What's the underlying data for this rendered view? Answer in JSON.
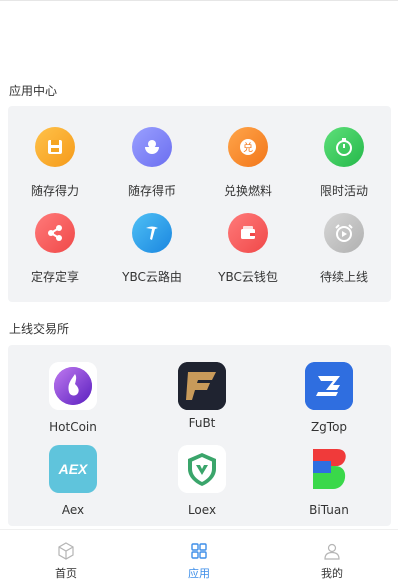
{
  "sections": {
    "apps_title": "应用中心",
    "exchanges_title": "上线交易所"
  },
  "apps": [
    {
      "label": "随存得力",
      "icon": "floppy-icon",
      "color": "#f5a623"
    },
    {
      "label": "随存得币",
      "icon": "bowl-icon",
      "color": "#7b7ff0"
    },
    {
      "label": "兑换燃料",
      "icon": "exchange-icon",
      "color": "#f58a1f"
    },
    {
      "label": "限时活动",
      "icon": "stopwatch-icon",
      "color": "#34c759"
    },
    {
      "label": "定存定享",
      "icon": "share-icon",
      "color": "#f25a5a"
    },
    {
      "label": "YBC云路由",
      "icon": "router-icon",
      "color": "#2b9be8"
    },
    {
      "label": "YBC云钱包",
      "icon": "wallet-icon",
      "color": "#f25a5a"
    },
    {
      "label": "待续上线",
      "icon": "alarm-clock-icon",
      "color": "#b8b8b8"
    }
  ],
  "exchanges": [
    {
      "label": "HotCoin",
      "icon": "hotcoin-logo-icon"
    },
    {
      "label": "FuBt",
      "icon": "fubt-logo-icon"
    },
    {
      "label": "ZgTop",
      "icon": "zgtop-logo-icon"
    },
    {
      "label": "Aex",
      "icon": "aex-logo-icon",
      "logo_text": "AEX"
    },
    {
      "label": "Loex",
      "icon": "loex-logo-icon"
    },
    {
      "label": "BiTuan",
      "icon": "bituan-logo-icon"
    }
  ],
  "tabbar": {
    "home": "首页",
    "apps": "应用",
    "mine": "我的",
    "active_color": "#3d8ee8"
  }
}
